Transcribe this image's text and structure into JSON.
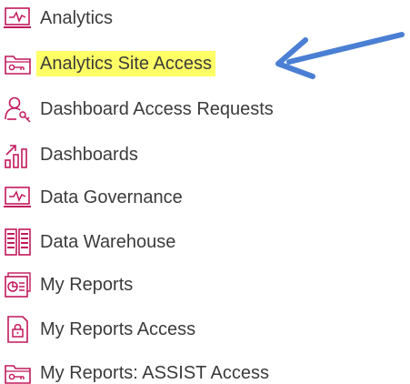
{
  "menu": {
    "items": [
      {
        "label": "Analytics",
        "icon": "monitor-pulse-icon"
      },
      {
        "label": "Analytics Site Access",
        "icon": "folder-key-icon",
        "highlighted": true
      },
      {
        "label": "Dashboard Access Requests",
        "icon": "user-key-icon"
      },
      {
        "label": "Dashboards",
        "icon": "bar-chart-trend-icon"
      },
      {
        "label": "Data Governance",
        "icon": "monitor-pulse-icon"
      },
      {
        "label": "Data Warehouse",
        "icon": "server-rack-icon"
      },
      {
        "label": "My Reports",
        "icon": "report-pie-icon"
      },
      {
        "label": "My Reports Access",
        "icon": "document-lock-icon"
      },
      {
        "label": "My Reports: ASSIST Access",
        "icon": "folder-key-icon"
      }
    ]
  },
  "colors": {
    "icon": "#c2185b",
    "text": "#3b3b3b",
    "highlight": "#ffff66",
    "arrow": "#4a7fd4"
  }
}
